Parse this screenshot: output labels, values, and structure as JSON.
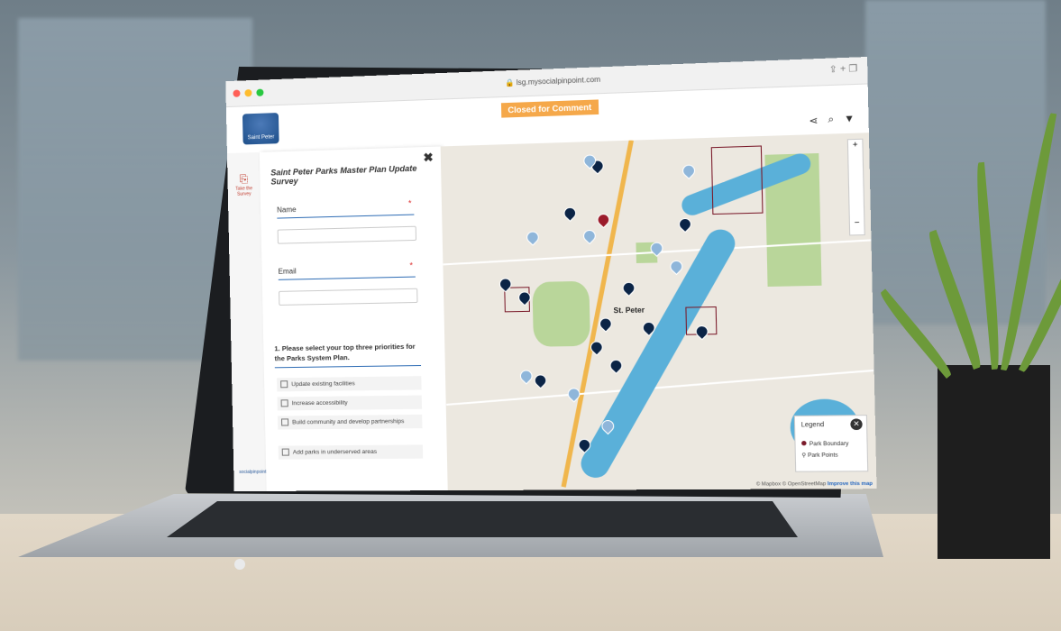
{
  "browser": {
    "url": "lsg.mysocialpinpoint.com",
    "traffic_colors": [
      "#ff5f57",
      "#febc2e",
      "#28c840"
    ]
  },
  "header": {
    "logo_text": "Saint Peter",
    "status_badge": "Closed for Comment",
    "status_color": "#f5a84a"
  },
  "rail": {
    "take_survey_label": "Take the Survey",
    "footer_logo_text": "socialpinpoint"
  },
  "survey": {
    "title": "Saint Peter Parks Master Plan Update Survey",
    "name_label": "Name",
    "email_label": "Email",
    "question": "1. Please select your top three priorities for the Parks System Plan.",
    "options": [
      "Update existing facilities",
      "Increase accessibility",
      "Build community and develop partnerships",
      "Add parks in underserved areas"
    ]
  },
  "map": {
    "town_label": "St. Peter",
    "legend": {
      "title": "Legend",
      "items": [
        "Park Boundary",
        "Park Points"
      ]
    },
    "attribution_prefix": "© Mapbox © OpenStreetMap",
    "attribution_link": "Improve this map",
    "zoom_in": "+",
    "zoom_out": "−",
    "pin_colors": {
      "dark": "#0b2446",
      "light": "#8fb6da",
      "red": "#9b1b2a"
    }
  }
}
